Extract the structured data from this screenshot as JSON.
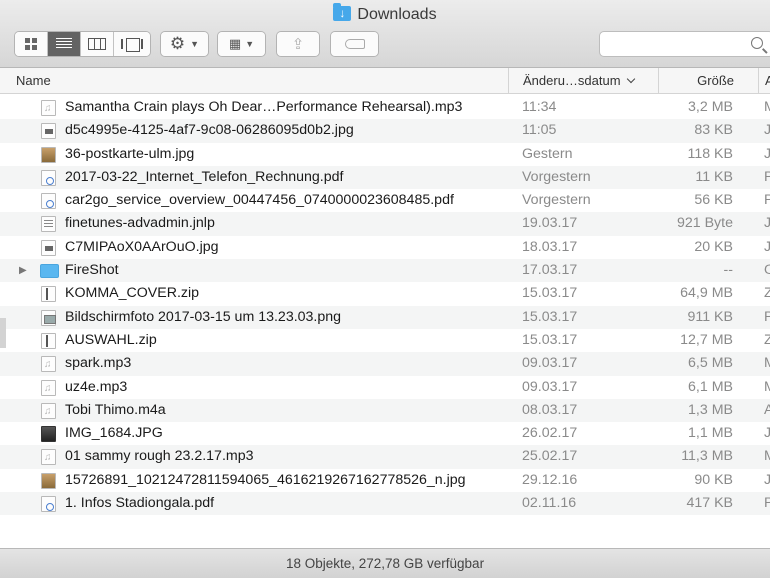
{
  "window": {
    "title": "Downloads"
  },
  "toolbar": {
    "search_placeholder": ""
  },
  "columns": {
    "name": "Name",
    "date": "Änderu…sdatum",
    "size": "Größe",
    "kind": "A"
  },
  "files": [
    {
      "name": "Samantha Crain plays Oh Dear…Performance Rehearsal).mp3",
      "date": "11:34",
      "size": "3,2 MB",
      "kind": "M",
      "icon": "audio"
    },
    {
      "name": "d5c4995e-4125-4af7-9c08-06286095d0b2.jpg",
      "date": "11:05",
      "size": "83 KB",
      "kind": "J",
      "icon": "image"
    },
    {
      "name": "36-postkarte-ulm.jpg",
      "date": "Gestern",
      "size": "118 KB",
      "kind": "J",
      "icon": "photo"
    },
    {
      "name": "2017-03-22_Internet_Telefon_Rechnung.pdf",
      "date": "Vorgestern",
      "size": "11 KB",
      "kind": "P",
      "icon": "pdf"
    },
    {
      "name": "car2go_service_overview_00447456_0740000023608485.pdf",
      "date": "Vorgestern",
      "size": "56 KB",
      "kind": "P",
      "icon": "pdf"
    },
    {
      "name": "finetunes-advadmin.jnlp",
      "date": "19.03.17",
      "size": "921 Byte",
      "kind": "J",
      "icon": "java"
    },
    {
      "name": "C7MIPAoX0AArOuO.jpg",
      "date": "18.03.17",
      "size": "20 KB",
      "kind": "J",
      "icon": "image"
    },
    {
      "name": "FireShot",
      "date": "17.03.17",
      "size": "--",
      "kind": "O",
      "icon": "folder",
      "disclosure": "▶"
    },
    {
      "name": "KOMMA_COVER.zip",
      "date": "15.03.17",
      "size": "64,9 MB",
      "kind": "Z",
      "icon": "zip"
    },
    {
      "name": "Bildschirmfoto 2017-03-15 um 13.23.03.png",
      "date": "15.03.17",
      "size": "911 KB",
      "kind": "P",
      "icon": "screen"
    },
    {
      "name": "AUSWAHL.zip",
      "date": "15.03.17",
      "size": "12,7 MB",
      "kind": "Z",
      "icon": "zip"
    },
    {
      "name": "spark.mp3",
      "date": "09.03.17",
      "size": "6,5 MB",
      "kind": "M",
      "icon": "audio"
    },
    {
      "name": "uz4e.mp3",
      "date": "09.03.17",
      "size": "6,1 MB",
      "kind": "M",
      "icon": "audio"
    },
    {
      "name": "Tobi Thimo.m4a",
      "date": "08.03.17",
      "size": "1,3 MB",
      "kind": "A",
      "icon": "audio"
    },
    {
      "name": "IMG_1684.JPG",
      "date": "26.02.17",
      "size": "1,1 MB",
      "kind": "J",
      "icon": "dark"
    },
    {
      "name": "01 sammy rough 23.2.17.mp3",
      "date": "25.02.17",
      "size": "11,3 MB",
      "kind": "M",
      "icon": "audio"
    },
    {
      "name": "15726891_10212472811594065_4616219267162778526_n.jpg",
      "date": "29.12.16",
      "size": "90 KB",
      "kind": "J",
      "icon": "photo"
    },
    {
      "name": "1. Infos Stadiongala.pdf",
      "date": "02.11.16",
      "size": "417 KB",
      "kind": "P",
      "icon": "pdf"
    }
  ],
  "status": {
    "text": "18 Objekte, 272,78 GB verfügbar"
  }
}
